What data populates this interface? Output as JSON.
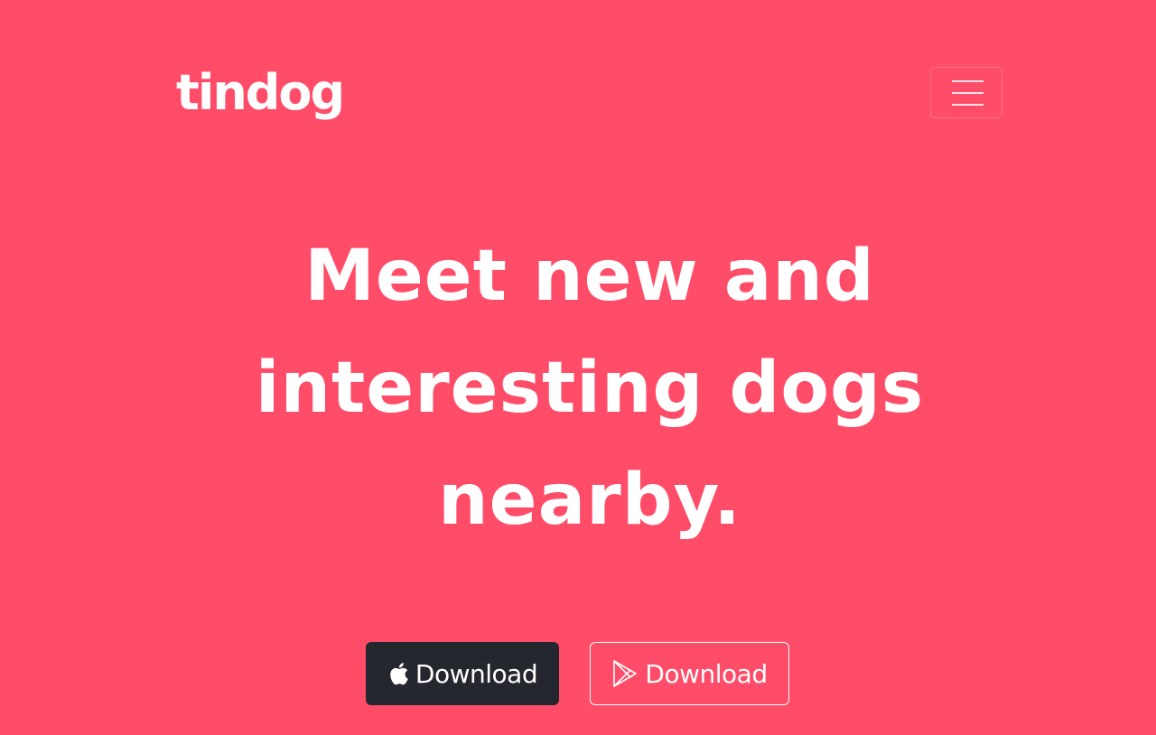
{
  "navbar": {
    "brand": "tindog",
    "toggler_icon": "hamburger-menu-icon"
  },
  "hero": {
    "headline_lines": [
      "Meet new and",
      "interesting dogs",
      "nearby."
    ]
  },
  "buttons": {
    "apple": {
      "label": "Download",
      "icon": "apple-icon"
    },
    "play": {
      "label": "Download",
      "icon": "google-play-icon"
    }
  },
  "colors": {
    "background": "#ff4c68",
    "text": "#ffffff",
    "dark_button": "#24272d"
  }
}
